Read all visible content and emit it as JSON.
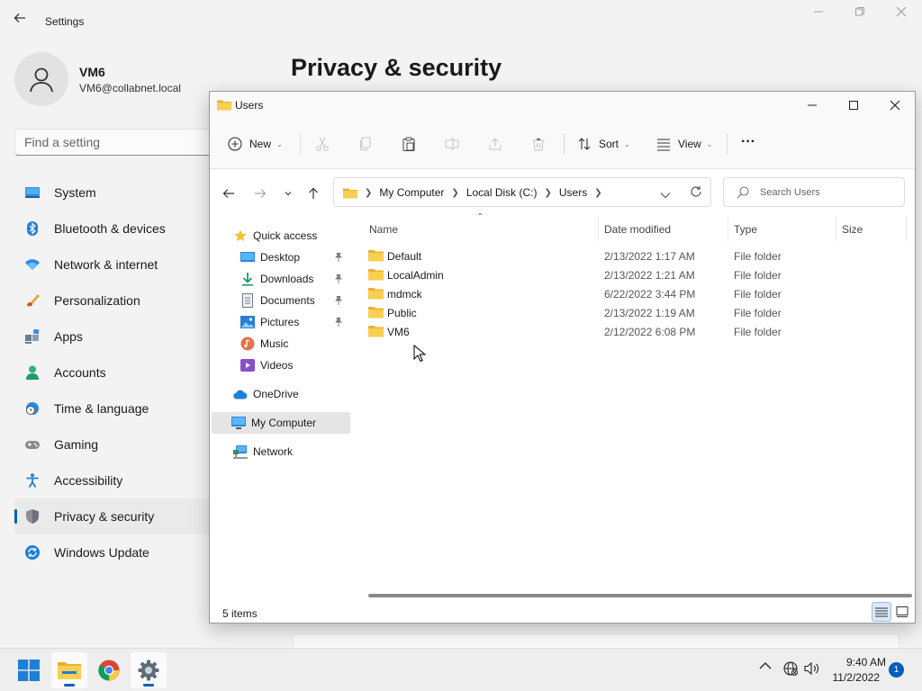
{
  "settings": {
    "title": "Settings",
    "profile": {
      "name": "VM6",
      "email": "VM6@collabnet.local"
    },
    "search_placeholder": "Find a setting",
    "page_title": "Privacy & security",
    "nav": [
      {
        "label": "System",
        "icon": "monitor-icon"
      },
      {
        "label": "Bluetooth & devices",
        "icon": "bluetooth-icon"
      },
      {
        "label": "Network & internet",
        "icon": "wifi-icon"
      },
      {
        "label": "Personalization",
        "icon": "brush-icon"
      },
      {
        "label": "Apps",
        "icon": "apps-icon"
      },
      {
        "label": "Accounts",
        "icon": "person-icon"
      },
      {
        "label": "Time & language",
        "icon": "clock-globe-icon"
      },
      {
        "label": "Gaming",
        "icon": "gamepad-icon"
      },
      {
        "label": "Accessibility",
        "icon": "accessibility-icon"
      },
      {
        "label": "Privacy & security",
        "icon": "shield-icon",
        "active": true
      },
      {
        "label": "Windows Update",
        "icon": "update-icon"
      }
    ]
  },
  "explorer": {
    "title": "Users",
    "toolbar": {
      "new_label": "New",
      "sort_label": "Sort",
      "view_label": "View",
      "more_label": "···"
    },
    "breadcrumb": [
      "My Computer",
      "Local Disk (C:)",
      "Users"
    ],
    "search_placeholder": "Search Users",
    "nav_pane": {
      "quick_access": "Quick access",
      "quick_items": [
        {
          "label": "Desktop",
          "icon": "desktop-icon",
          "pinned": true
        },
        {
          "label": "Downloads",
          "icon": "download-icon",
          "pinned": true
        },
        {
          "label": "Documents",
          "icon": "document-icon",
          "pinned": true
        },
        {
          "label": "Pictures",
          "icon": "picture-icon",
          "pinned": true
        },
        {
          "label": "Music",
          "icon": "music-icon",
          "pinned": false
        },
        {
          "label": "Videos",
          "icon": "video-icon",
          "pinned": false
        }
      ],
      "onedrive": "OneDrive",
      "my_computer": "My Computer",
      "network": "Network"
    },
    "columns": {
      "name": "Name",
      "date": "Date modified",
      "type": "Type",
      "size": "Size"
    },
    "rows": [
      {
        "name": "Default",
        "date": "2/13/2022 1:17 AM",
        "type": "File folder"
      },
      {
        "name": "LocalAdmin",
        "date": "2/13/2022 1:21 AM",
        "type": "File folder"
      },
      {
        "name": "mdmck",
        "date": "6/22/2022 3:44 PM",
        "type": "File folder"
      },
      {
        "name": "Public",
        "date": "2/13/2022 1:19 AM",
        "type": "File folder"
      },
      {
        "name": "VM6",
        "date": "2/12/2022 6:08 PM",
        "type": "File folder"
      }
    ],
    "status": "5 items"
  },
  "taskbar": {
    "time": "9:40 AM",
    "date": "11/2/2022",
    "notifications": "1"
  },
  "colors": {
    "accent": "#005fb8",
    "folder": "#f5c342"
  }
}
